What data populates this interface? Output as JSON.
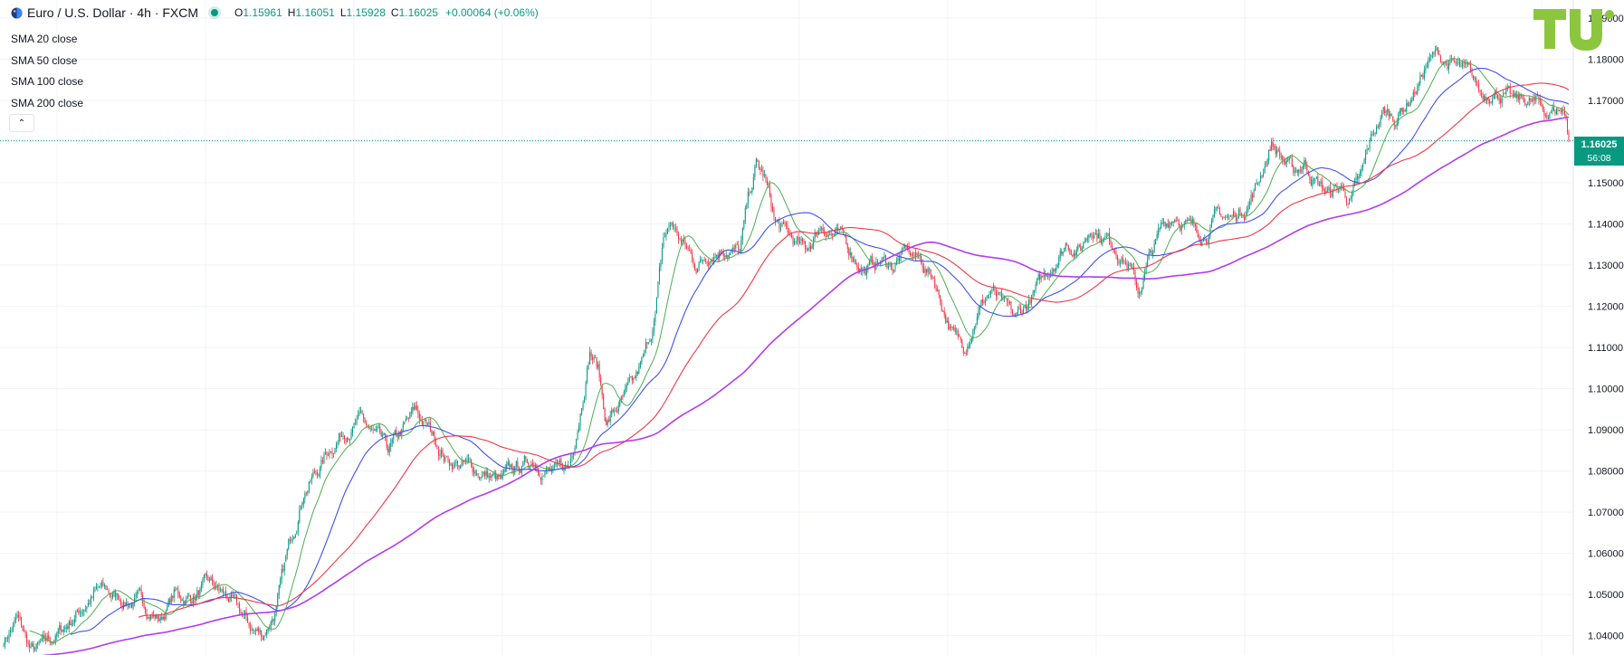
{
  "header": {
    "symbol": "Euro / U.S. Dollar · 4h · FXCM",
    "open_label": "O",
    "open": "1.15961",
    "high_label": "H",
    "high": "1.16051",
    "low_label": "L",
    "low": "1.15928",
    "close_label": "C",
    "close": "1.16025",
    "change": "+0.00064 (+0.06%)"
  },
  "legend": {
    "items": [
      "SMA 20 close",
      "SMA 50 close",
      "SMA 100 close",
      "SMA 200 close"
    ]
  },
  "logo_text": "TV",
  "price_tag": {
    "price": "1.16025",
    "countdown": "56:08"
  },
  "colors": {
    "up": "#089981",
    "down": "#f23645",
    "sma20": "#4caf50",
    "sma50": "#3f51f5",
    "sma100": "#f23645",
    "sma200": "#b23bef",
    "logo": "#8cc63f"
  },
  "chart_data": {
    "type": "candlestick",
    "instrument": "Euro / U.S. Dollar",
    "timeframe": "4h",
    "ylim": [
      1.0353,
      1.1944
    ],
    "yticks": [
      1.04,
      1.05,
      1.06,
      1.07,
      1.08,
      1.09,
      1.1,
      1.11,
      1.12,
      1.13,
      1.14,
      1.15,
      1.16,
      1.17,
      1.18,
      1.19
    ],
    "ytick_labels": [
      "1.04000",
      "1.05000",
      "1.06000",
      "1.07000",
      "1.08000",
      "1.09000",
      "1.10000",
      "1.11000",
      "1.12000",
      "1.13000",
      "1.14000",
      "1.15000",
      "1.16000",
      "1.17000",
      "1.18000",
      "1.19000"
    ],
    "last_price": 1.16025,
    "grid": true,
    "price_anchors": [
      [
        0,
        1.039
      ],
      [
        10,
        1.044
      ],
      [
        20,
        1.036
      ],
      [
        30,
        1.037
      ],
      [
        45,
        1.042
      ],
      [
        60,
        1.048
      ],
      [
        70,
        1.051
      ],
      [
        85,
        1.049
      ],
      [
        100,
        1.048
      ],
      [
        115,
        1.044
      ],
      [
        125,
        1.05
      ],
      [
        135,
        1.049
      ],
      [
        150,
        1.052
      ],
      [
        165,
        1.049
      ],
      [
        180,
        1.042
      ],
      [
        190,
        1.04
      ],
      [
        200,
        1.047
      ],
      [
        210,
        1.062
      ],
      [
        220,
        1.076
      ],
      [
        230,
        1.08
      ],
      [
        240,
        1.086
      ],
      [
        252,
        1.091
      ],
      [
        262,
        1.092
      ],
      [
        272,
        1.088
      ],
      [
        282,
        1.084
      ],
      [
        292,
        1.089
      ],
      [
        302,
        1.094
      ],
      [
        312,
        1.09
      ],
      [
        325,
        1.083
      ],
      [
        340,
        1.081
      ],
      [
        355,
        1.079
      ],
      [
        365,
        1.077
      ],
      [
        375,
        1.08
      ],
      [
        390,
        1.083
      ],
      [
        405,
        1.079
      ],
      [
        415,
        1.081
      ],
      [
        422,
        1.094
      ],
      [
        430,
        1.11
      ],
      [
        436,
        1.105
      ],
      [
        442,
        1.092
      ],
      [
        452,
        1.096
      ],
      [
        462,
        1.1
      ],
      [
        470,
        1.107
      ],
      [
        478,
        1.118
      ],
      [
        484,
        1.136
      ],
      [
        490,
        1.14
      ],
      [
        498,
        1.135
      ],
      [
        508,
        1.13
      ],
      [
        520,
        1.134
      ],
      [
        530,
        1.135
      ],
      [
        540,
        1.133
      ],
      [
        546,
        1.145
      ],
      [
        552,
        1.154
      ],
      [
        558,
        1.151
      ],
      [
        566,
        1.14
      ],
      [
        578,
        1.136
      ],
      [
        588,
        1.133
      ],
      [
        600,
        1.14
      ],
      [
        612,
        1.137
      ],
      [
        622,
        1.133
      ],
      [
        632,
        1.129
      ],
      [
        642,
        1.131
      ],
      [
        652,
        1.13
      ],
      [
        662,
        1.133
      ],
      [
        672,
        1.131
      ],
      [
        682,
        1.127
      ],
      [
        690,
        1.119
      ],
      [
        698,
        1.112
      ],
      [
        704,
        1.11
      ],
      [
        714,
        1.119
      ],
      [
        724,
        1.124
      ],
      [
        734,
        1.119
      ],
      [
        742,
        1.116
      ],
      [
        752,
        1.121
      ],
      [
        762,
        1.126
      ],
      [
        772,
        1.132
      ],
      [
        780,
        1.136
      ],
      [
        790,
        1.134
      ],
      [
        798,
        1.14
      ],
      [
        808,
        1.137
      ],
      [
        818,
        1.134
      ],
      [
        826,
        1.13
      ],
      [
        832,
        1.123
      ],
      [
        840,
        1.131
      ],
      [
        850,
        1.139
      ],
      [
        860,
        1.143
      ],
      [
        870,
        1.139
      ],
      [
        880,
        1.138
      ],
      [
        890,
        1.142
      ],
      [
        900,
        1.141
      ],
      [
        910,
        1.144
      ],
      [
        920,
        1.15
      ],
      [
        930,
        1.16
      ],
      [
        938,
        1.156
      ],
      [
        946,
        1.152
      ],
      [
        954,
        1.155
      ],
      [
        964,
        1.15
      ],
      [
        972,
        1.147
      ],
      [
        980,
        1.149
      ],
      [
        988,
        1.146
      ],
      [
        996,
        1.151
      ],
      [
        1004,
        1.161
      ],
      [
        1012,
        1.167
      ],
      [
        1020,
        1.166
      ],
      [
        1028,
        1.169
      ],
      [
        1036,
        1.173
      ],
      [
        1044,
        1.179
      ],
      [
        1052,
        1.181
      ],
      [
        1060,
        1.179
      ],
      [
        1068,
        1.177
      ],
      [
        1076,
        1.175
      ],
      [
        1084,
        1.171
      ],
      [
        1092,
        1.173
      ],
      [
        1100,
        1.172
      ],
      [
        1108,
        1.169
      ],
      [
        1116,
        1.17
      ],
      [
        1124,
        1.169
      ],
      [
        1132,
        1.167
      ],
      [
        1140,
        1.168
      ],
      [
        1146,
        1.167
      ],
      [
        1148,
        1.1603
      ]
    ],
    "series": [
      {
        "name": "SMA 20 close"
      },
      {
        "name": "SMA 50 close"
      },
      {
        "name": "SMA 100 close"
      },
      {
        "name": "SMA 200 close"
      }
    ]
  }
}
